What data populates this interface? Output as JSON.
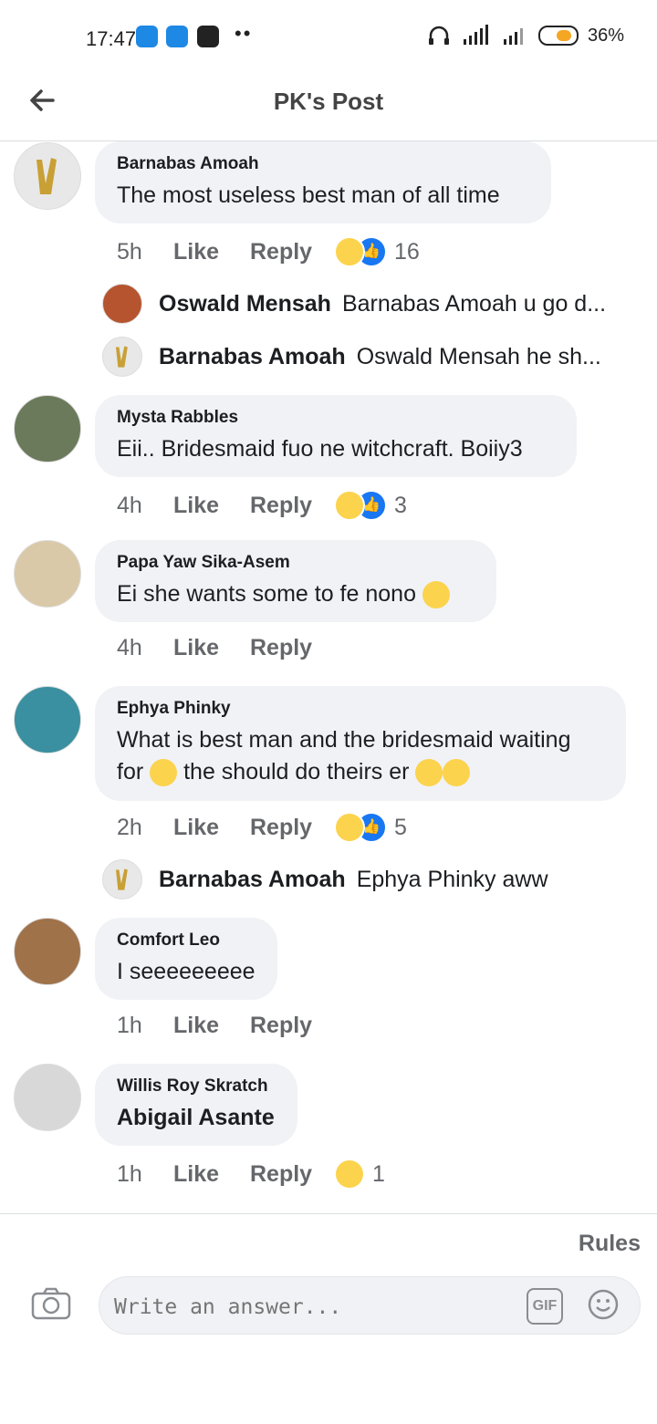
{
  "status_bar": {
    "time": "17:47",
    "dots": "••",
    "battery_pct": "36%",
    "battery_level": 0.36
  },
  "header": {
    "title": "PK's Post"
  },
  "comments": [
    {
      "author": "Barnabas Amoah",
      "text": "The most useless best man of all time",
      "time": "5h",
      "like": "Like",
      "reply": "Reply",
      "reaction_count": "16"
    },
    {
      "author": "Mysta Rabbles",
      "text": "Eii.. Bridesmaid fuo ne witchcraft. Boiiy3",
      "time": "4h",
      "like": "Like",
      "reply": "Reply",
      "reaction_count": "3"
    },
    {
      "author": "Papa Yaw Sika-Asem",
      "text": "Ei she wants some to fe nono",
      "time": "4h",
      "like": "Like",
      "reply": "Reply"
    },
    {
      "author": "Ephya Phinky",
      "text_line1": "What is best man and the bridesmaid waiting",
      "text_line2a": "for",
      "text_line2b": "the should do theirs er",
      "time": "2h",
      "like": "Like",
      "reply": "Reply",
      "reaction_count": "5"
    },
    {
      "author": "Comfort Leo",
      "text": "I seeeeeeeee",
      "time": "1h",
      "like": "Like",
      "reply": "Reply"
    },
    {
      "author": "Willis Roy Skratch",
      "text": "Abigail Asante",
      "time": "1h",
      "like": "Like",
      "reply": "Reply",
      "reaction_count": "1"
    }
  ],
  "replies": [
    {
      "author": "Oswald Mensah",
      "text": "Barnabas Amoah u go d..."
    },
    {
      "author": "Barnabas Amoah",
      "text": "Oswald Mensah he sh..."
    },
    {
      "author": "Barnabas Amoah",
      "text": "Ephya Phinky aww"
    }
  ],
  "footer": {
    "rules": "Rules",
    "placeholder": "Write an answer...",
    "gif": "GIF"
  },
  "colors": {
    "accent": "#1877f2",
    "bubble": "#f0f2f5",
    "meta": "#65676b",
    "haha": "#fcd34d"
  }
}
